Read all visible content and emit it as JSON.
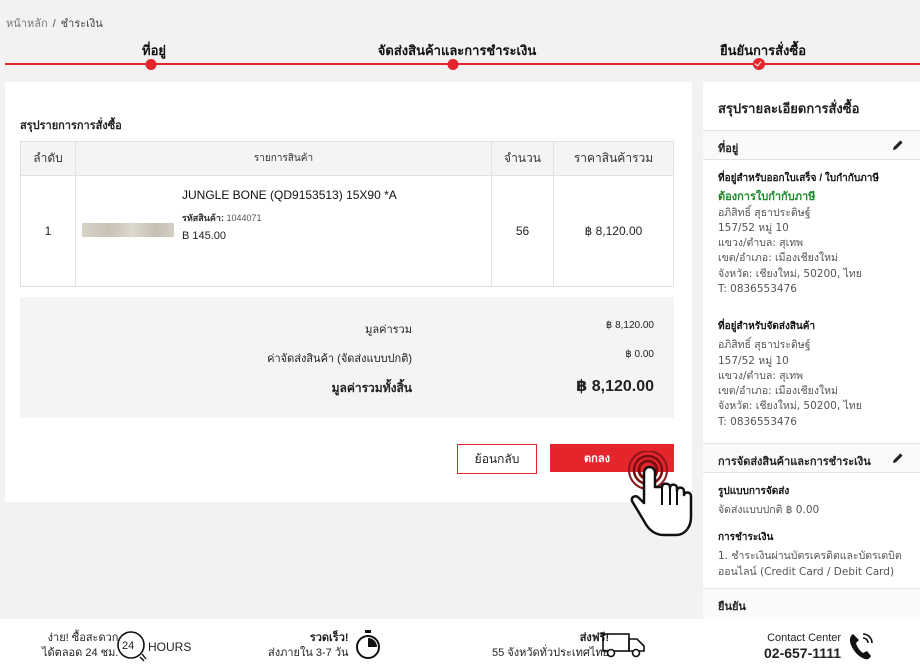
{
  "breadcrumb": {
    "home": "หน้าหลัก",
    "separator": "/",
    "current": "ชำระเงิน"
  },
  "steps": [
    {
      "label": "ที่อยู่"
    },
    {
      "label": "จัดส่งสินค้าและการชำระเงิน"
    },
    {
      "label": "ยืนยันการสั่งซื้อ"
    }
  ],
  "order": {
    "title": "สรุปรายการการสั่งซื้อ",
    "columns": [
      "ลำดับ",
      "รายการสินค้า",
      "จำนวน",
      "ราคาสินค้ารวม"
    ],
    "items": [
      {
        "index": "1",
        "name": "JUNGLE BONE (QD9153513) 15X90 *A",
        "code_label": "รหัสสินค้า:",
        "code": "1044071",
        "price": "B 145.00",
        "qty": "56",
        "total": "฿ 8,120.00"
      }
    ],
    "summary": {
      "subtotal_label": "มูลค่ารวม",
      "subtotal": "฿ 8,120.00",
      "shipping_label": "ค่าจัดส่งสินค้า (จัดส่งแบบปกติ)",
      "shipping": "฿ 0.00",
      "grand_label": "มูลค่ารวมทั้งสิ้น",
      "grand": "฿ 8,120.00"
    },
    "back_label": "ย้อนกลับ",
    "confirm_label": "ตกลง"
  },
  "sidebar": {
    "title": "สรุปรายละเอียดการสั่งซื้อ",
    "address_section": "ที่อยู่",
    "billing": {
      "heading": "ที่อยู่สำหรับออกใบเสร็จ / ใบกำกับภาษี",
      "tax_note": "ต้องการใบกำกับภาษี",
      "lines": [
        "อภิสิทธิ์ สุธาประดิษฐ์",
        "157/52 หมู่ 10",
        "แขวง/ตำบล: สุเทพ",
        "เขต/อำเภอ: เมืองเชียงใหม่",
        "จังหวัด: เชียงใหม่, 50200, ไทย",
        "T: 0836553476"
      ]
    },
    "shipping": {
      "heading": "ที่อยู่สำหรับจัดส่งสินค้า",
      "lines": [
        "อภิสิทธิ์ สุธาประดิษฐ์",
        "157/52 หมู่ 10",
        "แขวง/ตำบล: สุเทพ",
        "เขต/อำเภอ: เมืองเชียงใหม่",
        "จังหวัด: เชียงใหม่, 50200, ไทย",
        "T: 0836553476"
      ]
    },
    "delivery_section": "การจัดส่งสินค้าและการชำระเงิน",
    "delivery_method_heading": "รูปแบบการจัดส่ง",
    "delivery_method": "จัดส่งแบบปกติ ฿ 0.00",
    "payment_heading": "การชำระเงิน",
    "payment_lines": [
      "1. ชำระเงินผ่านบัตรเครดิตและบัตรเดบิต",
      "ออนไลน์ (Credit Card / Debit Card)"
    ],
    "confirm_section": "ยืนยัน"
  },
  "footer": {
    "easy_title": "ง่าย! ซื้อสะดวก",
    "easy_sub": "ได้ตลอด 24 ชม.",
    "hours_number": "24",
    "hours_label": "HOURS",
    "fast_title": "รวดเร็ว!",
    "fast_sub": "ส่งภายใน 3-7 วัน",
    "free_title": "ส่งฟรี!",
    "free_sub": "55 จังหวัดทั่วประเทศไทย",
    "contact_title": "Contact Center",
    "contact_phone": "02-657-1111"
  },
  "icons": [
    "pencil-icon",
    "clock-24-icon",
    "stopwatch-icon",
    "truck-icon",
    "phone-icon",
    "hand-pointer-icon"
  ],
  "colors": {
    "accent": "#e4252c",
    "tax_note": "#1f8a2a"
  }
}
